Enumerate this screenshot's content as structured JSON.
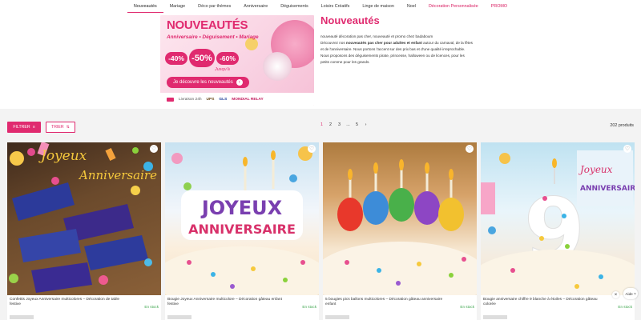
{
  "nav": {
    "items": [
      {
        "label": "Nouveautés",
        "active": true
      },
      {
        "label": "Mariage"
      },
      {
        "label": "Déco par thèmes"
      },
      {
        "label": "Anniversaire"
      },
      {
        "label": "Déguisements"
      },
      {
        "label": "Loisirs Créatifs"
      },
      {
        "label": "Linge de maison"
      },
      {
        "label": "Noel"
      },
      {
        "label": "Décoration Personnalisée",
        "pink": true
      },
      {
        "label": "PROMO",
        "pink": true
      }
    ]
  },
  "banner": {
    "title": "NOUVEAUTÉS",
    "subtitle": "Anniversaire • Déguisement • Mariage",
    "percents": [
      "-40%",
      "-50%",
      "-60%"
    ],
    "jusqua": "Jusqu'à",
    "cta": "Je découvre les nouveautés",
    "delivery_label": "Livraison 24h",
    "carrier_ups": "UPS",
    "carrier_gls": "GLS",
    "carrier_relay": "MONDIAL RELAY"
  },
  "intro": {
    "title": "Nouveautés",
    "line1": "nouveauté décoration pas cher, nouveauté et promo chez badaboum",
    "line2_pre": "Découvrez nos ",
    "line2_bold": "nouveautés pas cher pour adultes et enfant",
    "line2_post": " autour du carnaval, de la fêtes",
    "line3": "et de l'anniversaire. Nous portons l'accent sur des prix bas et d'une qualité irreprochable.",
    "line4": "Nous proposons des déguisements pirate, princesse, halloween ou de licences, pour les",
    "line5": "petits comme pour les grands."
  },
  "toolbar": {
    "filter_label": "FILTRER",
    "sort_label": "TRIER",
    "pages": [
      "1",
      "2",
      "3",
      "...",
      "5",
      "›"
    ],
    "current_page": "1",
    "product_count": "202 produits"
  },
  "products": [
    {
      "name": "Confettis Joyeux Anniversaire multicolores – Décoration de table festive",
      "stock": "En stock"
    },
    {
      "name": "Bougie Joyeux Anniversaire multicolore – Décoration gâteau enfant festive",
      "stock": "En stock"
    },
    {
      "name": "5 bougies pics ballons multicolores – Décoration gâteau anniversaire enfant",
      "stock": "En stock"
    },
    {
      "name": "Bougie anniversaire chiffre 9 blanche à étoiles – Décoration gâteau colorée",
      "stock": "En stock"
    }
  ],
  "images": {
    "p1_word1": "Joyeux",
    "p1_word2": "Anniversaire",
    "p2_word1": "JOYEUX",
    "p2_word2": "ANNIVERSAIRE",
    "p4_word1": "Joyeux",
    "p4_word2": "ANNIVERSAIRE",
    "p4_digit": "9"
  },
  "chat": {
    "label": "Aide ?",
    "close": "×"
  },
  "colors": {
    "accent": "#e02a6f",
    "stock": "#3aa44a"
  }
}
